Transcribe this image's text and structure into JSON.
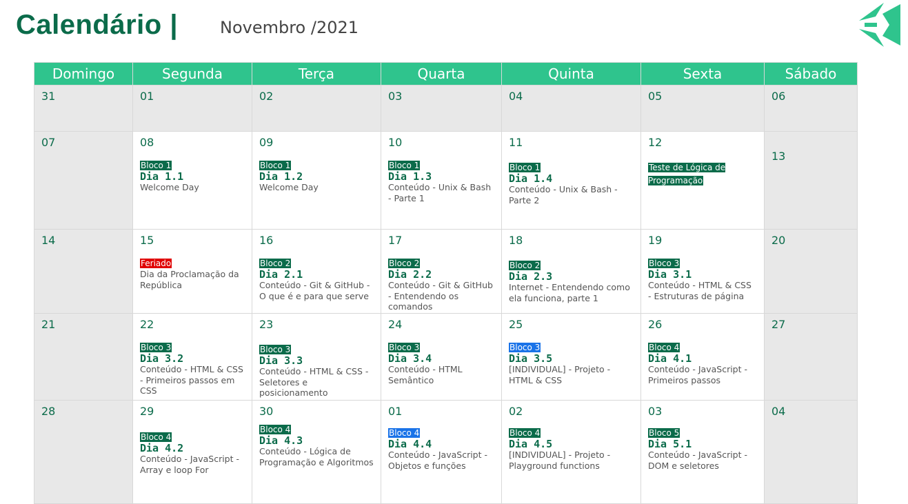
{
  "header": {
    "title": "Calendário |",
    "month": "Novembro /2021"
  },
  "weekdays": [
    "Domingo",
    "Segunda",
    "Terça",
    "Quarta",
    "Quinta",
    "Sexta",
    "Sábado"
  ],
  "colors": {
    "primary": "#0b6b4a",
    "header_bg": "#2fc48d",
    "blue_badge": "#1a73e8",
    "holiday": "#e00000",
    "weekend_bg": "#e8e8e8"
  },
  "logo": {
    "icon": "paper-plane-logo-icon"
  },
  "weeks": [
    {
      "days": [
        {
          "num": "31"
        },
        {
          "num": "01"
        },
        {
          "num": "02"
        },
        {
          "num": "03"
        },
        {
          "num": "04"
        },
        {
          "num": "05"
        },
        {
          "num": "06"
        }
      ]
    },
    {
      "days": [
        {
          "num": "07"
        },
        {
          "num": "08",
          "badge": "Bloco 1",
          "day": "Dia 1.1",
          "desc": "Welcome Day"
        },
        {
          "num": "09",
          "badge": "Bloco 1",
          "day": "Dia 1.2",
          "desc": "Welcome Day"
        },
        {
          "num": "10",
          "badge": "Bloco 1",
          "day": "Dia 1.3",
          "desc": "Conteúdo - Unix & Bash - Parte 1"
        },
        {
          "num": "11",
          "badge": "Bloco 1",
          "day": "Dia 1.4",
          "desc": "Conteúdo - Unix & Bash - Parte 2"
        },
        {
          "num": "12",
          "badge": "Teste de Lógica de Programação"
        },
        {
          "num": "13"
        }
      ]
    },
    {
      "days": [
        {
          "num": "14"
        },
        {
          "num": "15",
          "badge": "Feriado",
          "desc": "Dia da Proclamação da República"
        },
        {
          "num": "16",
          "badge": "Bloco 2",
          "day": "Dia 2.1",
          "desc": "Conteúdo - Git & GitHub - O que é e para que serve"
        },
        {
          "num": "17",
          "badge": "Bloco 2",
          "day": "Dia 2.2",
          "desc": "Conteúdo - Git & GitHub - Entendendo os comandos"
        },
        {
          "num": "18",
          "badge": "Bloco 2",
          "day": "Dia 2.3",
          "desc": "Internet - Entendendo como ela funciona, parte 1"
        },
        {
          "num": "19",
          "badge": "Bloco 3",
          "day": "Dia 3.1",
          "desc": "Conteúdo - HTML & CSS - Estruturas de página"
        },
        {
          "num": "20"
        }
      ]
    },
    {
      "days": [
        {
          "num": "21"
        },
        {
          "num": "22",
          "badge": "Bloco 3",
          "day": "Dia 3.2",
          "desc": "Conteúdo - HTML & CSS - Primeiros passos em CSS"
        },
        {
          "num": "23",
          "badge": "Bloco 3",
          "day": "Dia 3.3",
          "desc": "Conteúdo - HTML & CSS - Seletores e posicionamento"
        },
        {
          "num": "24",
          "badge": "Bloco 3",
          "day": "Dia 3.4",
          "desc": "Conteúdo - HTML Semântico"
        },
        {
          "num": "25",
          "badge": "Bloco 3",
          "day": "Dia 3.5",
          "desc": "[INDIVIDUAL] - Projeto - HTML & CSS"
        },
        {
          "num": "26",
          "badge": "Bloco 4",
          "day": "Dia 4.1",
          "desc": "Conteúdo - JavaScript - Primeiros passos"
        },
        {
          "num": "27"
        }
      ]
    },
    {
      "days": [
        {
          "num": "28"
        },
        {
          "num": "29",
          "badge": "Bloco 4",
          "day": "Dia 4.2",
          "desc": "Conteúdo - JavaScript - Array e loop For"
        },
        {
          "num": "30",
          "badge": "Bloco 4",
          "day": "Dia 4.3",
          "desc": "Conteúdo - Lógica de Programação e Algoritmos"
        },
        {
          "num": "01",
          "badge": "Bloco 4",
          "day": "Dia 4.4",
          "desc": "Conteúdo - JavaScript - Objetos e funções"
        },
        {
          "num": "02",
          "badge": "Bloco 4",
          "day": "Dia 4.5",
          "desc": "[INDIVIDUAL] - Projeto - Playground functions"
        },
        {
          "num": "03",
          "badge": "Bloco 5",
          "day": "Dia 5.1",
          "desc": "Conteúdo - JavaScript - DOM e seletores"
        },
        {
          "num": "04"
        }
      ]
    }
  ]
}
